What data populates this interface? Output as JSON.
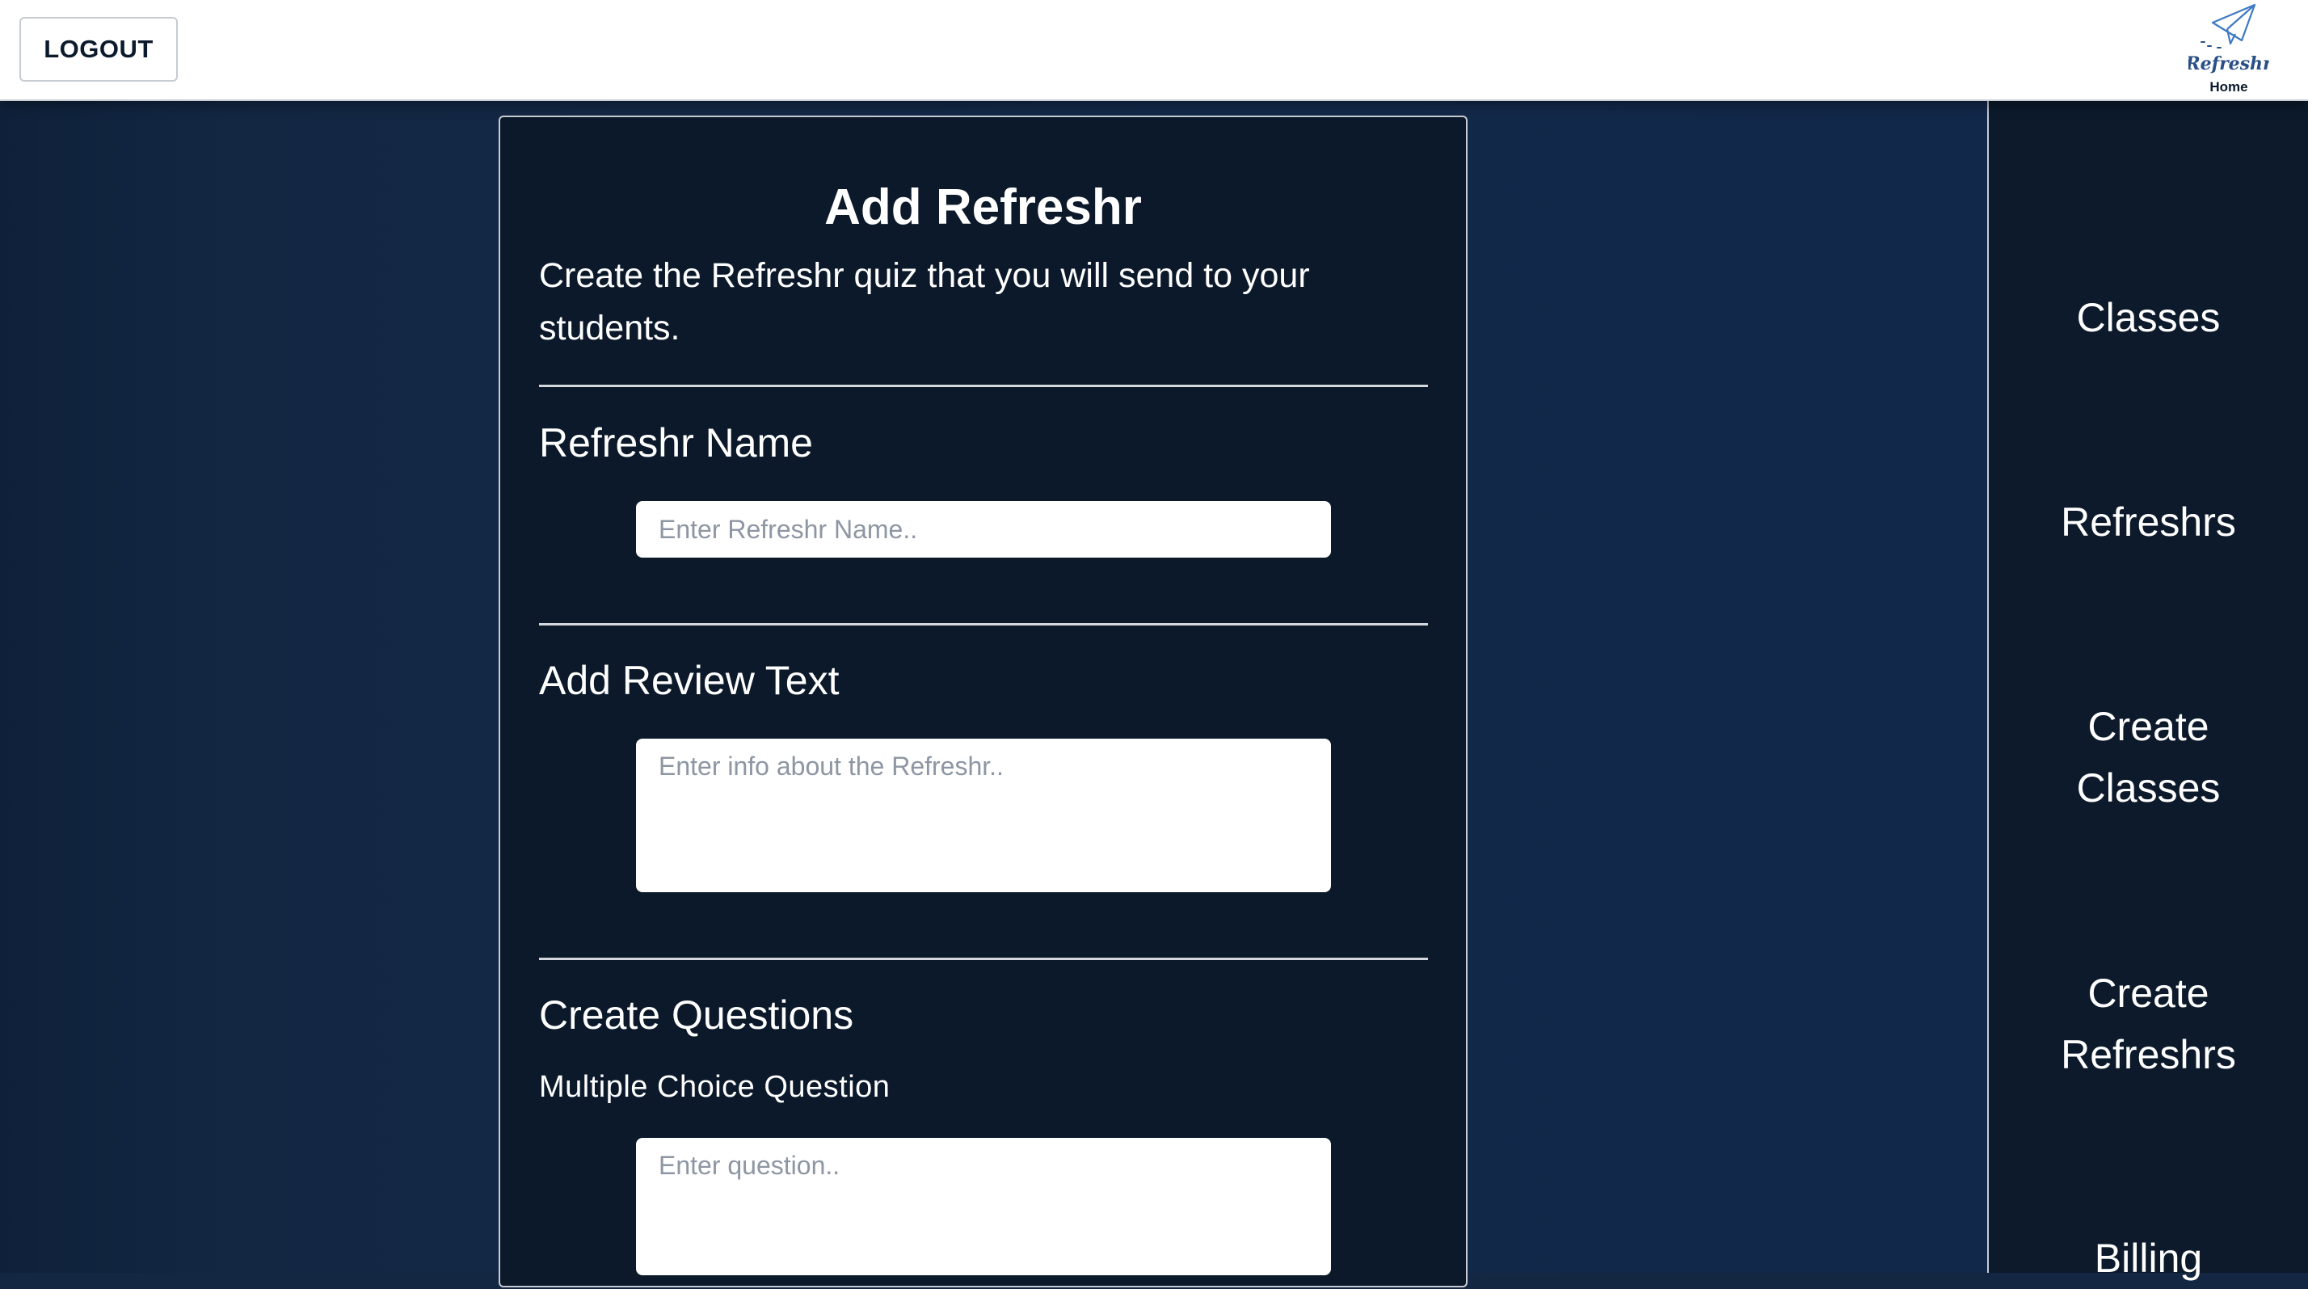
{
  "header": {
    "logout_label": "LOGOUT",
    "home_logo_text": "Refreshr",
    "home_label": "Home"
  },
  "colors": {
    "page_background": "#132743",
    "card_background": "#0b192a",
    "sidebar_background": "#0c1a2b",
    "logo_blue": "#3f79c4",
    "divider": "#d4d8de"
  },
  "sidebar": {
    "items": [
      {
        "label": "Classes",
        "icon": ""
      },
      {
        "label": "Refreshrs",
        "icon": ""
      },
      {
        "label": "Create\nClasses",
        "icon": ""
      },
      {
        "label": "Create\nRefreshrs",
        "icon": ""
      },
      {
        "label": "Billing",
        "icon": ""
      }
    ]
  },
  "form": {
    "title": "Add Refreshr",
    "description": "Create the Refreshr quiz that you will send to your students.",
    "name_section": {
      "label": "Refreshr Name",
      "placeholder": "Enter Refreshr Name..",
      "value": ""
    },
    "review_section": {
      "label": "Add Review Text",
      "placeholder": "Enter info about the Refreshr..",
      "value": ""
    },
    "questions_section": {
      "label": "Create Questions",
      "question_type": "Multiple Choice Question",
      "placeholder": "Enter question..",
      "value": ""
    }
  }
}
